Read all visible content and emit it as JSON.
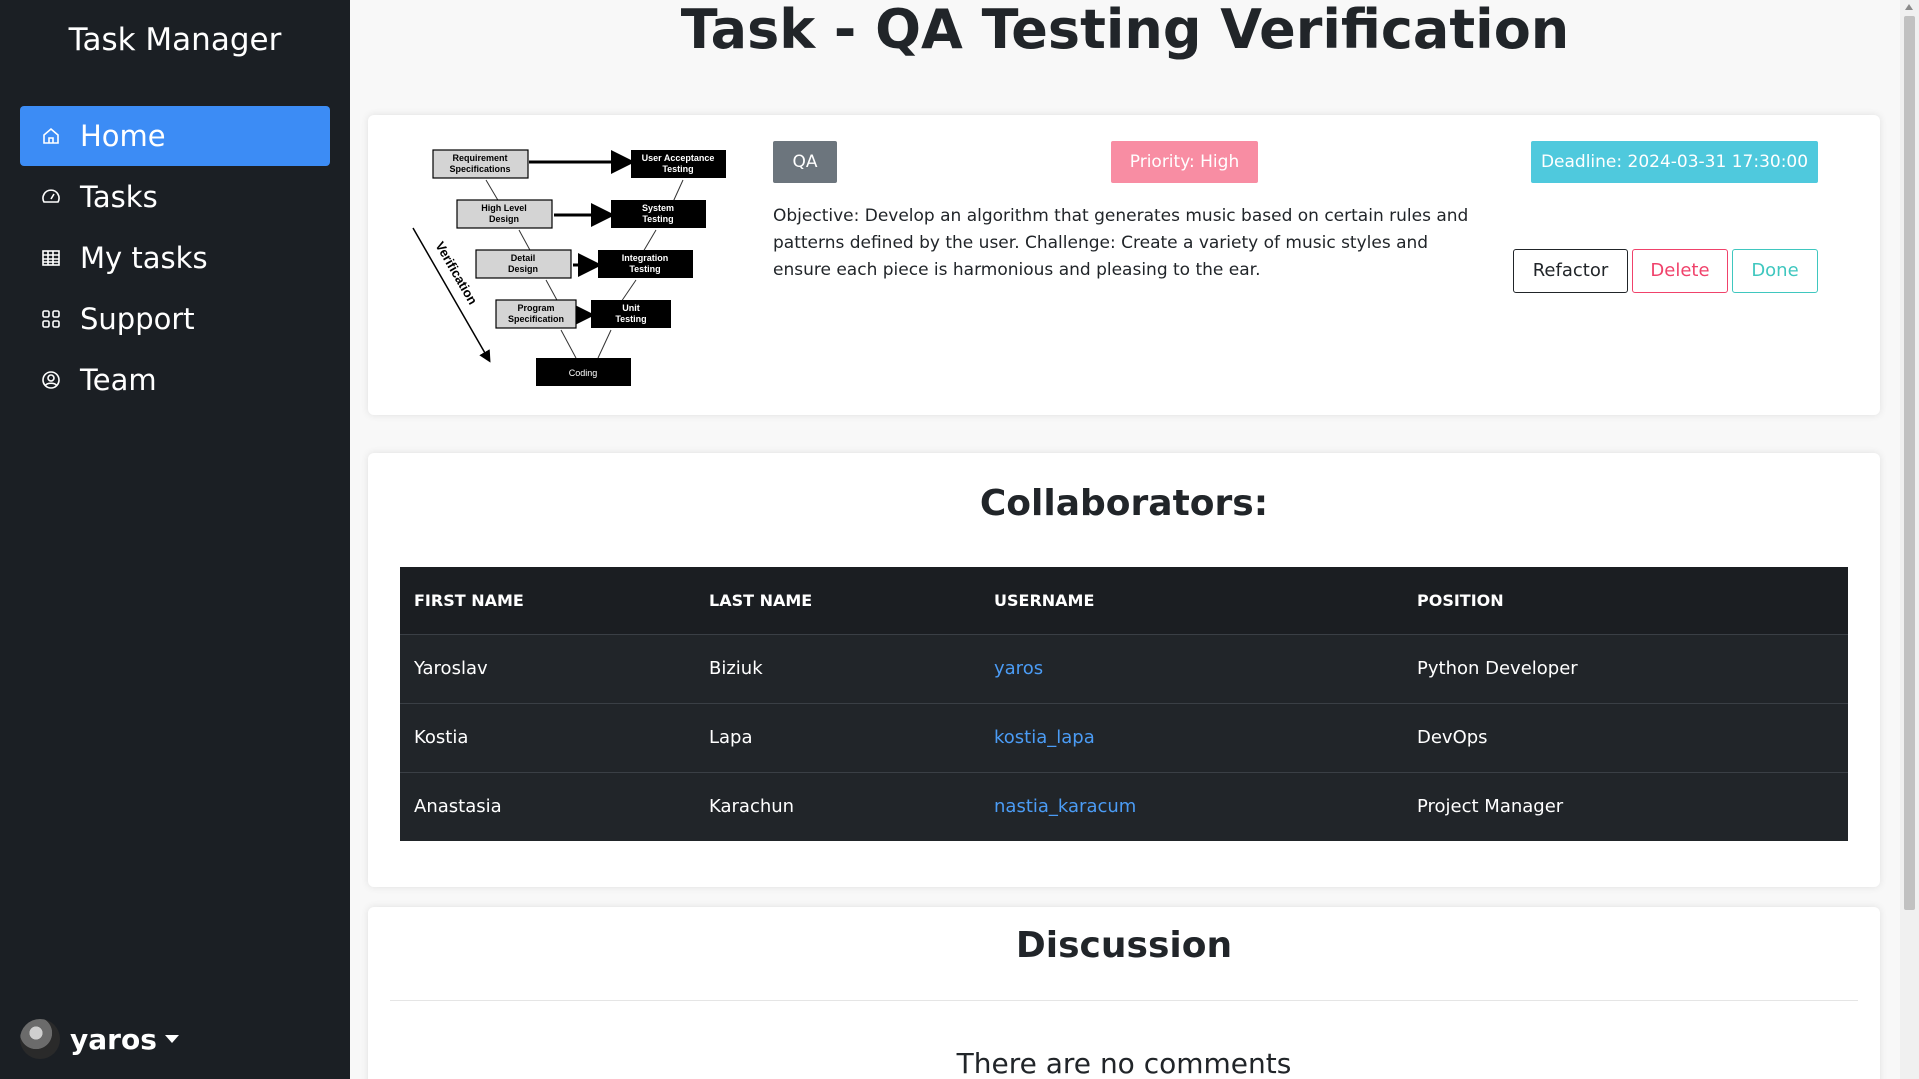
{
  "sidebar": {
    "brand": "Task Manager",
    "items": [
      {
        "label": "Home",
        "icon": "home-icon",
        "active": true
      },
      {
        "label": "Tasks",
        "icon": "speedometer-icon"
      },
      {
        "label": "My tasks",
        "icon": "table-icon"
      },
      {
        "label": "Support",
        "icon": "grid-icon"
      },
      {
        "label": "Team",
        "icon": "user-circle-icon"
      }
    ],
    "user": {
      "name": "yaros"
    }
  },
  "page": {
    "title": "Task - QA Testing Verification"
  },
  "task": {
    "type_badge": "QA",
    "priority": "Priority: High",
    "deadline": "Deadline: 2024-03-31 17:30:00",
    "objective": "Objective: Develop an algorithm that generates music based on certain rules and patterns defined by the user. Challenge: Create a variety of music styles and ensure each piece is harmonious and pleasing to the ear.",
    "buttons": {
      "refactor": "Refactor",
      "delete": "Delete",
      "done": "Done"
    },
    "diagram": {
      "boxes": [
        "Requirement Specifications",
        "High Level Design",
        "Detail Design",
        "Program Specification",
        "User Acceptance Testing",
        "System Testing",
        "Integration Testing",
        "Unit Testing",
        "Coding"
      ],
      "arrow_label": "Verification"
    }
  },
  "collaborators": {
    "title": "Collaborators:",
    "columns": [
      "FIRST NAME",
      "LAST NAME",
      "USERNAME",
      "POSITION"
    ],
    "rows": [
      {
        "first": "Yaroslav",
        "last": "Biziuk",
        "username": "yaros",
        "position": "Python Developer"
      },
      {
        "first": "Kostia",
        "last": "Lapa",
        "username": "kostia_lapa",
        "position": "DevOps"
      },
      {
        "first": "Anastasia",
        "last": "Karachun",
        "username": "nastia_karacum",
        "position": "Project Manager"
      }
    ]
  },
  "discussion": {
    "title": "Discussion",
    "empty_text": "There are no comments"
  },
  "colors": {
    "sidebar_bg": "#1b1f24",
    "active_nav": "#3c8cf5",
    "priority": "#f88da3",
    "deadline": "#4fc9dd",
    "delete": "#f0426b",
    "done": "#3fc7bf",
    "link": "#4b9cf5"
  }
}
